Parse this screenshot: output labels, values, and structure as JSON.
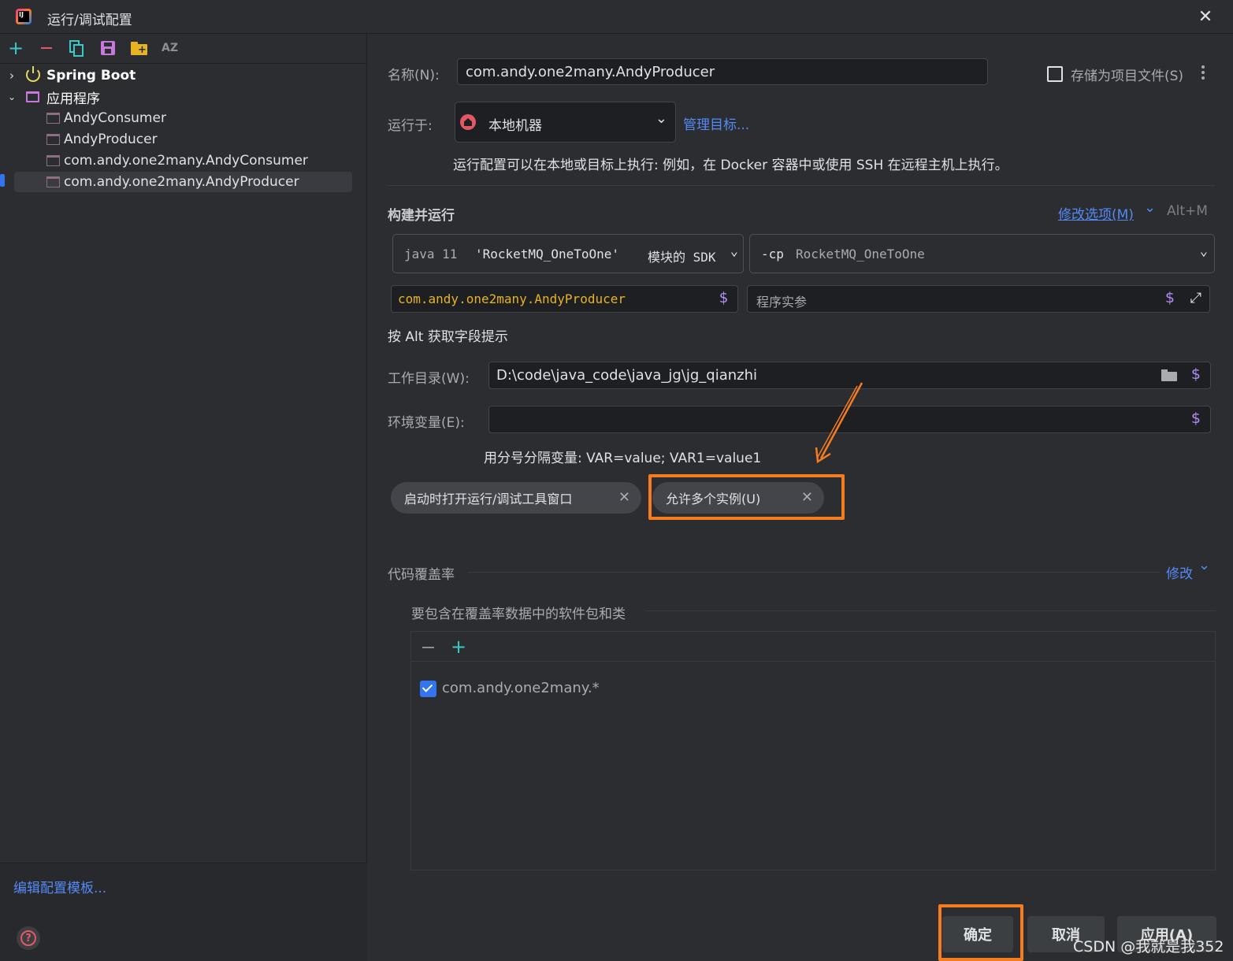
{
  "window": {
    "title": "运行/调试配置",
    "close_glyph": "✕"
  },
  "toolbar": {
    "icons": [
      "add-icon",
      "remove-icon",
      "copy-icon",
      "save-icon",
      "folder-add-icon",
      "sort-az-icon"
    ],
    "sort_label": "AZ"
  },
  "tree": {
    "spring_boot": "Spring Boot",
    "application": "应用程序",
    "items": [
      "AndyConsumer",
      "AndyProducer",
      "com.andy.one2many.AndyConsumer",
      "com.andy.one2many.AndyProducer"
    ],
    "selected_index": 3
  },
  "sidebar_footer": {
    "edit_templates": "编辑配置模板..."
  },
  "form": {
    "name_label": "名称(N):",
    "name_value": "com.andy.one2many.AndyProducer",
    "store_label": "存储为项目文件(S)",
    "run_on_label": "运行于:",
    "run_on_value": "本地机器",
    "manage_targets": "管理目标...",
    "run_on_hint": "运行配置可以在本地或目标上执行: 例如，在 Docker 容器中或使用 SSH 在远程主机上执行。",
    "build_run_title": "构建并运行",
    "modify_options": "修改选项(M)",
    "modify_shortcut": "Alt+M",
    "sdk_java": "java 11",
    "sdk_module": "'RocketMQ_OneToOne'",
    "sdk_suffix": "模块的 SDK",
    "cp_prefix": "-cp",
    "cp_value": "RocketMQ_OneToOne",
    "main_class": "com.andy.one2many.AndyProducer",
    "program_args_placeholder": "程序实参",
    "alt_hint": "按 Alt 获取字段提示",
    "workdir_label": "工作目录(W):",
    "workdir_value": "D:\\code\\java_code\\java_jg\\jg_qianzhi",
    "env_label": "环境变量(E):",
    "env_value": "",
    "env_hint": "用分号分隔变量: VAR=value; VAR1=value1",
    "tags": [
      "启动时打开运行/调试工具窗口",
      "允许多个实例(U)"
    ],
    "coverage_title": "代码覆盖率",
    "coverage_modify": "修改",
    "coverage_packages_title": "要包含在覆盖率数据中的软件包和类",
    "coverage_items": [
      {
        "label": "com.andy.one2many.*",
        "checked": true
      }
    ]
  },
  "buttons": {
    "ok": "确定",
    "cancel": "取消",
    "apply": "应用(A)"
  },
  "watermark": "CSDN @我就是我352",
  "colors": {
    "accent_link": "#548af7",
    "highlight": "#f57c1f",
    "background": "#2b2d30",
    "field": "#1e1f22"
  }
}
